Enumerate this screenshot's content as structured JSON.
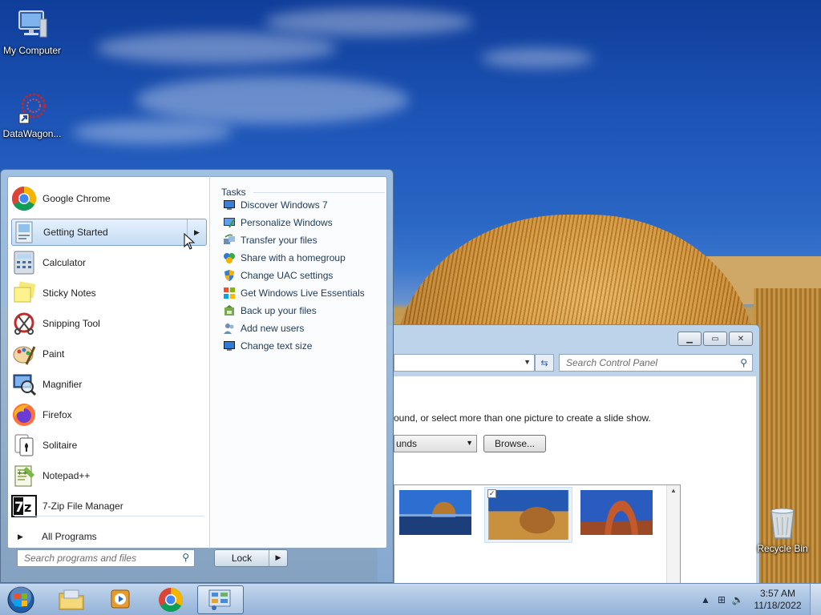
{
  "desktop": {
    "icons": [
      {
        "label": "My Computer",
        "icon": "computer-icon"
      },
      {
        "label": "DataWagon...",
        "icon": "datawagon-shortcut-icon"
      },
      {
        "label": "Recycle Bin",
        "icon": "recycle-bin-icon"
      }
    ]
  },
  "control_panel": {
    "search_placeholder": "Search Control Panel",
    "instruction_text": "ound, or select more than one picture to create a slide show.",
    "location_select": "unds",
    "browse_label": "Browse...",
    "thumbnails": [
      {
        "name": "thumbnail-rock-lake",
        "checked": false
      },
      {
        "name": "thumbnail-hay-bale",
        "checked": true
      },
      {
        "name": "thumbnail-arch",
        "checked": false
      }
    ]
  },
  "start_menu": {
    "programs": [
      {
        "label": "Google Chrome",
        "icon": "chrome-icon"
      },
      {
        "label": "Getting Started",
        "icon": "getting-started-icon",
        "has_submenu": true
      },
      {
        "label": "Calculator",
        "icon": "calculator-icon"
      },
      {
        "label": "Sticky Notes",
        "icon": "sticky-notes-icon"
      },
      {
        "label": "Snipping Tool",
        "icon": "snipping-tool-icon"
      },
      {
        "label": "Paint",
        "icon": "paint-icon"
      },
      {
        "label": "Magnifier",
        "icon": "magnifier-icon"
      },
      {
        "label": "Firefox",
        "icon": "firefox-icon"
      },
      {
        "label": "Solitaire",
        "icon": "solitaire-icon"
      },
      {
        "label": "Notepad++",
        "icon": "notepadpp-icon"
      },
      {
        "label": "7-Zip File Manager",
        "icon": "7zip-icon"
      }
    ],
    "all_programs_label": "All Programs",
    "tasks_heading": "Tasks",
    "tasks": [
      {
        "label": "Discover Windows 7",
        "icon": "monitor-icon"
      },
      {
        "label": "Personalize Windows",
        "icon": "personalize-icon"
      },
      {
        "label": "Transfer your files",
        "icon": "transfer-icon"
      },
      {
        "label": "Share with a homegroup",
        "icon": "homegroup-icon"
      },
      {
        "label": "Change UAC settings",
        "icon": "uac-shield-icon"
      },
      {
        "label": "Get Windows Live Essentials",
        "icon": "windows-flag-icon"
      },
      {
        "label": "Back up your files",
        "icon": "backup-icon"
      },
      {
        "label": "Add new users",
        "icon": "users-icon"
      },
      {
        "label": "Change text size",
        "icon": "text-size-icon"
      }
    ],
    "search_placeholder": "Search programs and files",
    "lock_label": "Lock"
  },
  "taskbar": {
    "pinned": [
      {
        "name": "explorer",
        "icon": "folder-icon"
      },
      {
        "name": "media-player",
        "icon": "media-player-icon"
      },
      {
        "name": "chrome",
        "icon": "chrome-icon"
      },
      {
        "name": "control-panel",
        "icon": "control-panel-icon",
        "active": true
      }
    ],
    "clock_time": "3:57 AM",
    "clock_date": "11/18/2022"
  }
}
